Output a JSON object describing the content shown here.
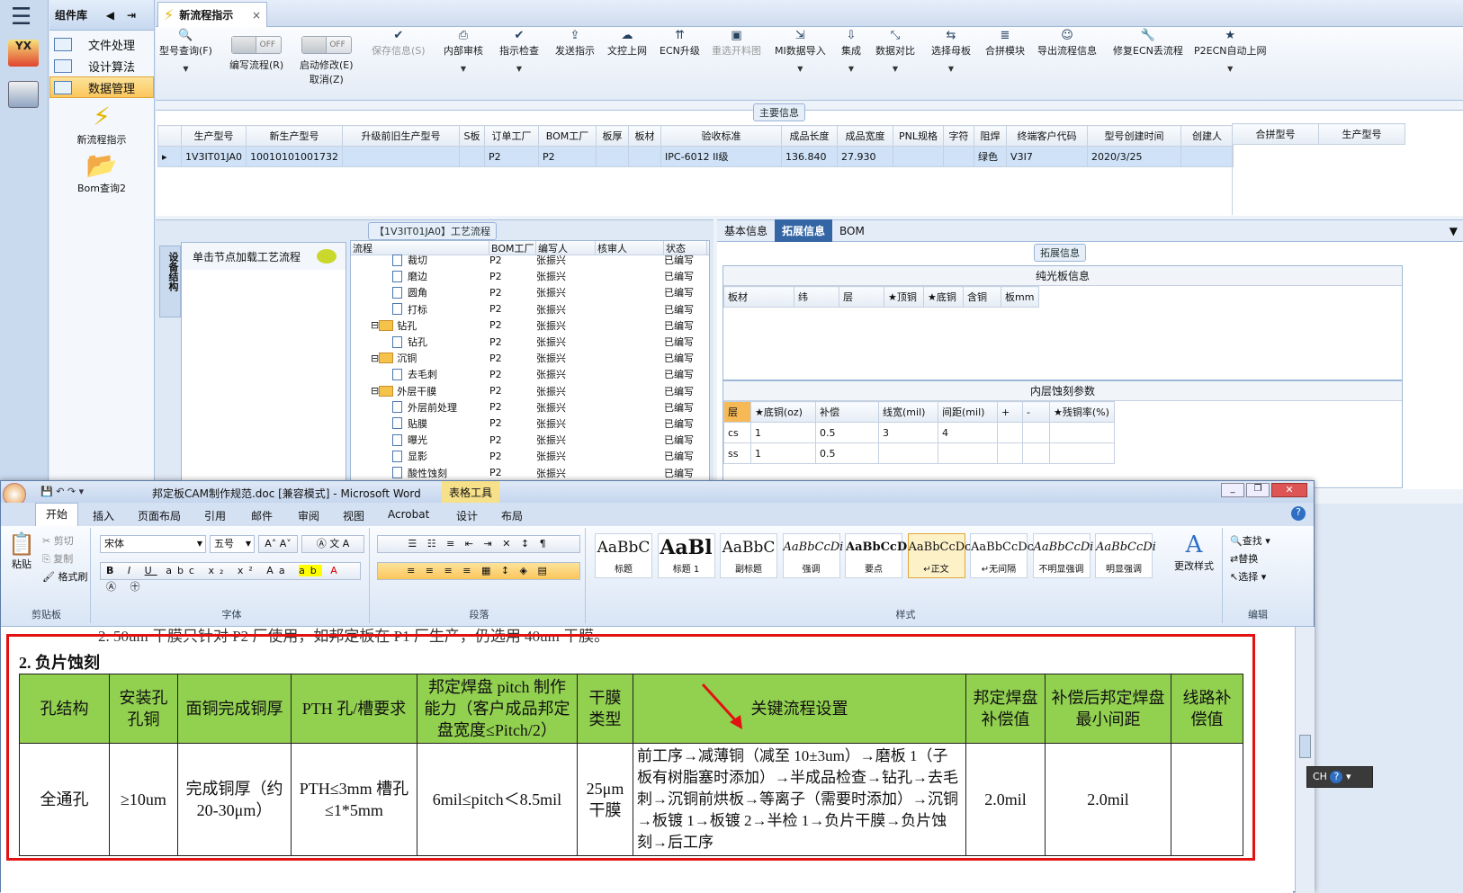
{
  "left_bar": {
    "logo": "YX"
  },
  "library": {
    "title": "组件库",
    "items": [
      "文件处理",
      "设计算法",
      "数据管理"
    ],
    "selected": 2,
    "tools": [
      "新流程指示",
      "Bom查询2"
    ]
  },
  "main_tab": {
    "title": "新流程指示"
  },
  "toolbar": [
    {
      "icon": "search",
      "label": "型号查询(F)",
      "dd": true
    },
    {
      "toggle": "OFF",
      "label": "编写流程(R)"
    },
    {
      "toggle": "OFF",
      "label": "启动修改(E)",
      "label2": "取消(Z)"
    },
    {
      "icon": "check",
      "label": "保存信息(S)",
      "disabled": true
    },
    {
      "icon": "print",
      "label": "内部审核",
      "dd": true
    },
    {
      "icon": "check",
      "label": "指示检查",
      "dd": true
    },
    {
      "icon": "upload",
      "label": "发送指示"
    },
    {
      "icon": "cloud",
      "label": "文控上网"
    },
    {
      "icon": "ecn",
      "label": "ECN升级"
    },
    {
      "icon": "image",
      "label": "重选开料图",
      "disabled": true
    },
    {
      "icon": "import",
      "label": "MI数据导入",
      "dd": true
    },
    {
      "icon": "download",
      "label": "集成",
      "dd": true
    },
    {
      "icon": "compare",
      "label": "数据对比",
      "dd": true
    },
    {
      "icon": "shuffle",
      "label": "选择母板",
      "dd": true
    },
    {
      "icon": "list",
      "label": "合拼模块"
    },
    {
      "icon": "smile",
      "label": "导出流程信息"
    },
    {
      "icon": "wrench",
      "label": "修复ECN丢流程"
    },
    {
      "icon": "star",
      "label": "P2ECN自动上网",
      "dd": true
    }
  ],
  "main_info": {
    "title": "主要信息",
    "columns": [
      "生产型号",
      "新生产型号",
      "升级前旧生产型号",
      "S板",
      "订单工厂",
      "BOM工厂",
      "板厚",
      "板材",
      "验收标准",
      "成品长度",
      "成品宽度",
      "PNL规格",
      "字符",
      "阻焊",
      "终端客户代码",
      "型号创建时间",
      "创建人"
    ],
    "row": [
      "1V3IT01JA0",
      "10010101001732",
      "",
      "",
      "P2",
      "P2",
      "",
      "",
      "IPC-6012 II级",
      "136.840",
      "27.930",
      "",
      "",
      "绿色",
      "V3I7",
      "2020/3/25",
      ""
    ],
    "side_columns": [
      "合拼型号",
      "生产型号"
    ]
  },
  "process": {
    "title": "【1V3IT01JA0】工艺流程",
    "side_tab": "设备结构",
    "hint": "单击节点加载工艺流程",
    "columns": [
      "流程",
      "BOM工厂",
      "编写人",
      "核审人",
      "状态"
    ],
    "rows": [
      {
        "name": "裁切",
        "type": "doc",
        "bom": "P2",
        "writer": "张振兴",
        "status": "已编写"
      },
      {
        "name": "磨边",
        "type": "doc",
        "bom": "P2",
        "writer": "张振兴",
        "status": "已编写"
      },
      {
        "name": "圆角",
        "type": "doc",
        "bom": "P2",
        "writer": "张振兴",
        "status": "已编写"
      },
      {
        "name": "打标",
        "type": "doc",
        "bom": "P2",
        "writer": "张振兴",
        "status": "已编写"
      },
      {
        "name": "钻孔",
        "type": "folder",
        "bom": "P2",
        "writer": "张振兴",
        "status": "已编写"
      },
      {
        "name": "钻孔",
        "type": "doc",
        "bom": "P2",
        "writer": "张振兴",
        "status": "已编写"
      },
      {
        "name": "沉铜",
        "type": "folder",
        "bom": "P2",
        "writer": "张振兴",
        "status": "已编写"
      },
      {
        "name": "去毛刺",
        "type": "doc",
        "bom": "P2",
        "writer": "张振兴",
        "status": "已编写"
      },
      {
        "name": "外层干膜",
        "type": "folder",
        "bom": "P2",
        "writer": "张振兴",
        "status": "已编写"
      },
      {
        "name": "外层前处理",
        "type": "doc",
        "bom": "P2",
        "writer": "张振兴",
        "status": "已编写"
      },
      {
        "name": "贴膜",
        "type": "doc",
        "bom": "P2",
        "writer": "张振兴",
        "status": "已编写"
      },
      {
        "name": "曝光",
        "type": "doc",
        "bom": "P2",
        "writer": "张振兴",
        "status": "已编写"
      },
      {
        "name": "显影",
        "type": "doc",
        "bom": "P2",
        "writer": "张振兴",
        "status": "已编写"
      },
      {
        "name": "酸性蚀刻",
        "type": "doc",
        "bom": "P2",
        "writer": "张振兴",
        "status": "已编写"
      }
    ]
  },
  "detail": {
    "tabs": [
      "基本信息",
      "拓展信息",
      "BOM"
    ],
    "active": 1,
    "section": "拓展信息",
    "bare_board": {
      "title": "纯光板信息",
      "columns": [
        "板材",
        "纬",
        "层",
        "★顶铜",
        "★底铜",
        "含铜",
        "板mm"
      ]
    },
    "inner_etch": {
      "title": "内层蚀刻参数",
      "columns": [
        "层",
        "★底铜(oz)",
        "补偿",
        "线宽(mil)",
        "间距(mil)",
        "+",
        "-",
        "★残铜率(%)"
      ],
      "rows": [
        [
          "cs",
          "1",
          "0.5",
          "3",
          "4",
          "",
          "",
          ""
        ],
        [
          "ss",
          "1",
          "0.5",
          "",
          "",
          "",
          "",
          ""
        ]
      ]
    }
  },
  "word": {
    "title": "邦定板CAM制作规范.doc [兼容模式] - Microsoft Word",
    "context_tab": "表格工具",
    "tabs": [
      "开始",
      "插入",
      "页面布局",
      "引用",
      "邮件",
      "审阅",
      "视图",
      "Acrobat",
      "设计",
      "布局"
    ],
    "clipboard": {
      "paste": "粘贴",
      "cut": "剪切",
      "copy": "复制",
      "format": "格式刷",
      "label": "剪贴板"
    },
    "font": {
      "name": "宋体",
      "size": "五号",
      "label": "字体"
    },
    "paragraph_label": "段落",
    "styles": [
      {
        "sample": "AaBbC",
        "name": "标题"
      },
      {
        "sample": "AaBl",
        "name": "标题 1"
      },
      {
        "sample": "AaBbC",
        "name": "副标题"
      },
      {
        "sample": "AaBbCcDi",
        "name": "强调"
      },
      {
        "sample": "AaBbCcD",
        "name": "要点"
      },
      {
        "sample": "AaBbCcDc",
        "name": "↵正文"
      },
      {
        "sample": "AaBbCcDc",
        "name": "↵无间隔"
      },
      {
        "sample": "AaBbCcDi",
        "name": "不明显强调"
      },
      {
        "sample": "AaBbCcDi",
        "name": "明显强调"
      }
    ],
    "change_styles": "更改样式",
    "styles_label": "样式",
    "edit": {
      "find": "查找",
      "replace": "替换",
      "select": "选择",
      "label": "编辑"
    },
    "doc_line": "2. 50um 干膜只针对 P2 厂使用，如邦定板在 P1 厂生产，仍选用 40um 干膜。",
    "heading": "2.  负片蚀刻",
    "table_header": [
      "孔结构",
      "安装孔孔铜",
      "面铜完成铜厚",
      "PTH 孔/槽要求",
      "邦定焊盘 pitch 制作能力（客户成品邦定盘宽度≤Pitch/2）",
      "干膜类型",
      "关键流程设置",
      "邦定焊盘补偿值",
      "补偿后邦定焊盘最小间距",
      "线路补偿值"
    ],
    "table_row": [
      "全通孔",
      "≥10um",
      "完成铜厚（约 20-30μm）",
      "PTH≤3mm 槽孔≤1*5mm",
      "6mil≤pitch＜8.5mil",
      "25μm 干膜",
      "前工序→减薄铜（减至 10±3um）→磨板 1（子板有树脂塞时添加）→半成品检查→钻孔→去毛刺→沉铜前烘板→等离子（需要时添加）→沉铜→板镀 1→板镀 2→半检 1→负片干膜→负片蚀刻→后工序",
      "2.0mil",
      "2.0mil",
      ""
    ]
  },
  "ime": {
    "text": "CH"
  }
}
